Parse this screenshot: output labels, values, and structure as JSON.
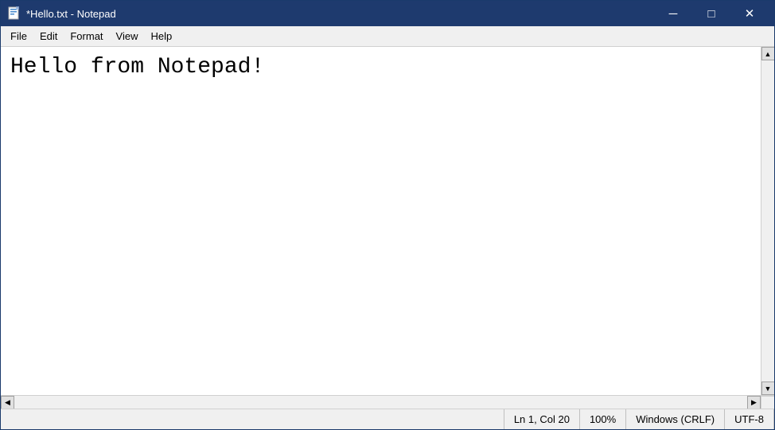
{
  "titleBar": {
    "icon": "notepad",
    "title": "*Hello.txt - Notepad",
    "minimizeLabel": "─",
    "maximizeLabel": "□",
    "closeLabel": "✕"
  },
  "menuBar": {
    "items": [
      {
        "id": "file",
        "label": "File"
      },
      {
        "id": "edit",
        "label": "Edit"
      },
      {
        "id": "format",
        "label": "Format"
      },
      {
        "id": "view",
        "label": "View"
      },
      {
        "id": "help",
        "label": "Help"
      }
    ]
  },
  "editor": {
    "content": "Hello from Notepad!"
  },
  "statusBar": {
    "position": "Ln 1, Col 20",
    "zoom": "100%",
    "lineEnding": "Windows (CRLF)",
    "encoding": "UTF-8"
  },
  "scrollbar": {
    "upArrow": "▲",
    "downArrow": "▼",
    "leftArrow": "◀",
    "rightArrow": "▶"
  }
}
